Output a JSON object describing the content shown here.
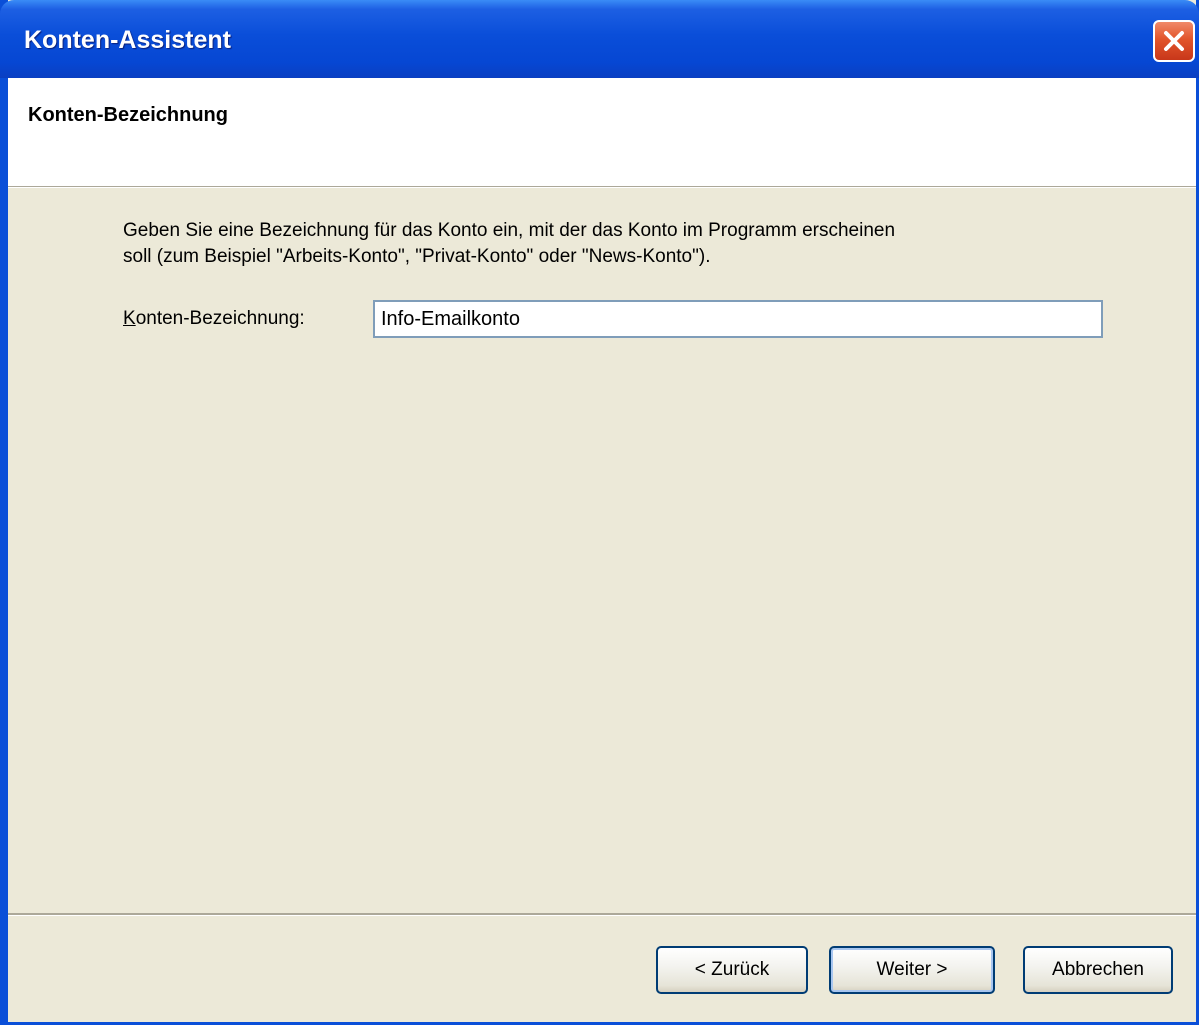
{
  "window": {
    "title": "Konten-Assistent",
    "close_icon": "close-x-icon",
    "accent_color": "#0a4ed9",
    "close_color": "#e2552b"
  },
  "header": {
    "title": "Konten-Bezeichnung"
  },
  "content": {
    "description_line1": "Geben Sie eine Bezeichnung für das Konto ein, mit der das Konto im Programm erscheinen",
    "description_line2": "soll (zum Beispiel \"Arbeits-Konto\", \"Privat-Konto\" oder \"News-Konto\").",
    "field_label_first": "K",
    "field_label_rest": "onten-Bezeichnung:",
    "field_value": "Info-Emailkonto"
  },
  "buttons": {
    "back": "< Zurück",
    "next": "Weiter >",
    "cancel": "Abbrechen"
  }
}
